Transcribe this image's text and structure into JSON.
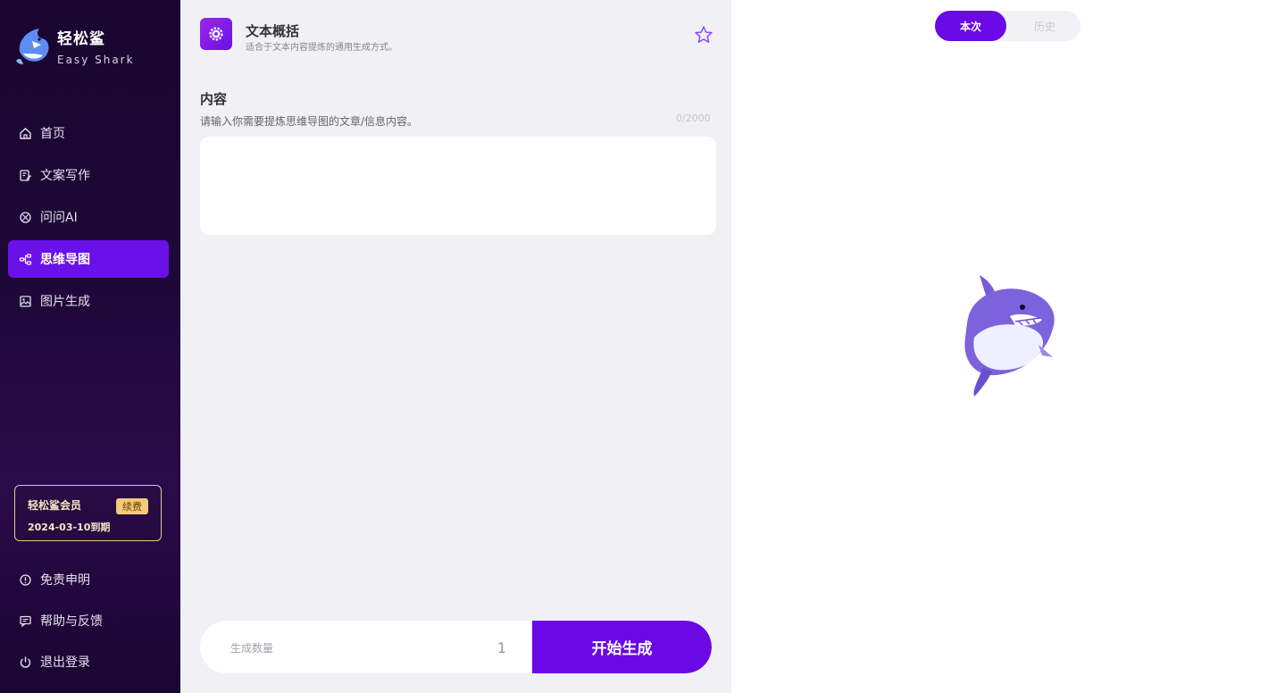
{
  "brand": {
    "name": "轻松鲨",
    "subtitle": "Easy Shark"
  },
  "nav": {
    "items": [
      {
        "label": "首页",
        "icon": "home-icon",
        "active": false
      },
      {
        "label": "文案写作",
        "icon": "edit-icon",
        "active": false
      },
      {
        "label": "问问AI",
        "icon": "ai-icon",
        "active": false
      },
      {
        "label": "思维导图",
        "icon": "mindmap-icon",
        "active": true
      },
      {
        "label": "图片生成",
        "icon": "image-icon",
        "active": false
      }
    ],
    "bottom": [
      {
        "label": "免责申明",
        "icon": "info-icon"
      },
      {
        "label": "帮助与反馈",
        "icon": "feedback-icon"
      },
      {
        "label": "退出登录",
        "icon": "power-icon"
      }
    ]
  },
  "membership": {
    "title": "轻松鲨会员",
    "renew_label": "续费",
    "expiry": "2024-03-10到期"
  },
  "tool": {
    "title": "文本概括",
    "description": "适合于文本内容提炼的通用生成方式。"
  },
  "content": {
    "label": "内容",
    "hint": "请输入你需要提炼思维导图的文章/信息内容。",
    "char_count": "0/2000",
    "placeholder": ""
  },
  "generate": {
    "quantity_label": "生成数量",
    "quantity_value": "1",
    "button_label": "开始生成"
  },
  "results": {
    "tabs": [
      {
        "label": "本次",
        "active": true
      },
      {
        "label": "历史",
        "active": false
      }
    ],
    "empty_line1": "",
    "empty_line2": ""
  },
  "colors": {
    "accent": "#6a08e6",
    "sidebar_bg": "#1e0838",
    "member_border": "#e8c98a"
  }
}
